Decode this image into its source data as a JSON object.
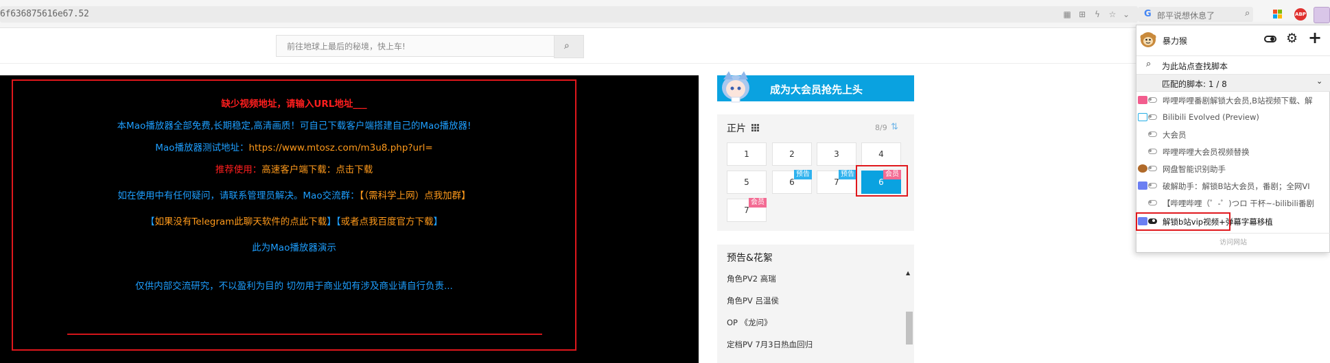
{
  "browser": {
    "url": "6f636875616e67.52",
    "search_placeholder": "郎平说想休息了",
    "abp_label": "ABP",
    "search_engine_glyph": "G"
  },
  "site": {
    "search_placeholder": "前往地球上最后的秘境，快上车!"
  },
  "player": {
    "line1": "缺少视频地址，请输入URL地址___",
    "line2": "本Mao播放器全部免费,长期稳定,高清画质！可自己下载客户端搭建自己的Mao播放器!",
    "line3_label": "Mao播放器测试地址：",
    "line3_url": "https://www.mtosz.com/m3u8.php?url=",
    "line4_label": "推荐使用：",
    "line4_text": "高速客户端下载：",
    "line4_link": "点击下载",
    "line5_text": "如在使用中有任何疑问，请联系管理员解决。Mao交流群：",
    "line5_link": "【（需科学上网）点我加群】",
    "line6_bracket_open": "【",
    "line6_link1": "如果没有Telegram此聊天软件的点此下载",
    "line6_bracket_mid": "】【",
    "line6_link2": "或者点我百度官方下载",
    "line6_bracket_close": "】",
    "line7": "此为Mao播放器演示",
    "line8": "仅供内部交流研究，不以盈利为目的    切勿用于商业如有涉及商业请自行负责..."
  },
  "vip_banner": {
    "text": "成为大会员抢先上头"
  },
  "episodes": {
    "title": "正片",
    "count": "8/9",
    "items": [
      {
        "label": "1",
        "badge": ""
      },
      {
        "label": "2",
        "badge": ""
      },
      {
        "label": "3",
        "badge": ""
      },
      {
        "label": "4",
        "badge": ""
      },
      {
        "label": "5",
        "badge": ""
      },
      {
        "label": "6",
        "badge": "预告"
      },
      {
        "label": "7",
        "badge": "预告"
      },
      {
        "label": "6",
        "badge": "会员"
      },
      {
        "label": "7",
        "badge": "会员"
      }
    ]
  },
  "trailers": {
    "title": "预告&花絮",
    "items": [
      "角色PV2 高瑞",
      "角色PV 吕温侯",
      "OP 《龙问》",
      "定档PV 7月3日热血回归"
    ]
  },
  "userscript_popup": {
    "name": "暴力猴",
    "find_scripts": "为此站点查找脚本",
    "matched": "匹配的脚本: 1 / 8",
    "scripts": [
      {
        "name": "哔哩哔哩番剧解锁大会员,B站视频下载、解",
        "enabled": false,
        "icon_color": "#f25d8e"
      },
      {
        "name": "Bilibili Evolved (Preview)",
        "enabled": false,
        "icon_color": "#23ade5"
      },
      {
        "name": "大会员",
        "enabled": false,
        "icon_color": ""
      },
      {
        "name": "哔哩哔哩大会员视频替换",
        "enabled": false,
        "icon_color": ""
      },
      {
        "name": "网盘智能识别助手",
        "enabled": false,
        "icon_color": "#b06a2a"
      },
      {
        "name": "破解助手：解锁B站大会员，番剧；全网VI",
        "enabled": false,
        "icon_color": "#6b7ff2"
      },
      {
        "name": "【哔哩哔哩（゜-゜)つロ 干杯~-bilibili番剧",
        "enabled": false,
        "icon_color": ""
      },
      {
        "name": "解锁b站vip视频+弹幕字幕移植",
        "enabled": true,
        "icon_color": "#6b7ff2"
      }
    ],
    "visit_site": "访问网站"
  }
}
